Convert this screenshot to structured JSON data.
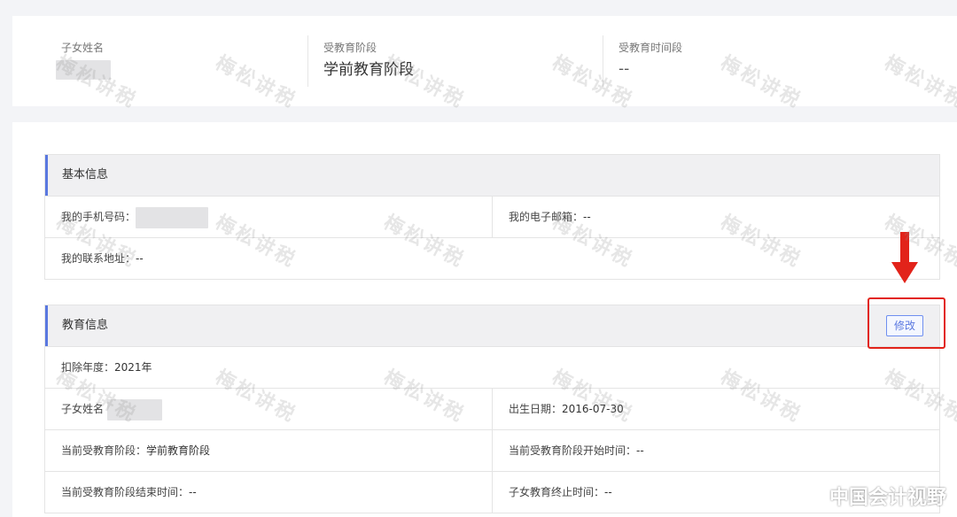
{
  "summary": {
    "child_name_label": "子女姓名",
    "edu_stage_label": "受教育阶段",
    "edu_stage_value": "学前教育阶段",
    "edu_period_label": "受教育时间段",
    "edu_period_value": "--"
  },
  "basic_info": {
    "title": "基本信息",
    "phone_label": "我的手机号码：",
    "email_label": "我的电子邮箱：",
    "email_value": "--",
    "address_label": "我的联系地址：",
    "address_value": "--"
  },
  "edu_info": {
    "title": "教育信息",
    "edit_label": "修改",
    "year_label": "扣除年度：",
    "year_value": "2021年",
    "child_name_label": "子女姓名",
    "birth_label": "出生日期：",
    "birth_value": "2016-07-30",
    "stage_label": "当前受教育阶段：",
    "stage_value": "学前教育阶段",
    "stage_start_label": "当前受教育阶段开始时间：",
    "stage_start_value": "--",
    "stage_end_label": "当前受教育阶段结束时间：",
    "stage_end_value": "--",
    "edu_end_label": "子女教育终止时间：",
    "edu_end_value": "--"
  },
  "watermark_text": "梅松讲税",
  "brand_text": "中国会计视野",
  "colors": {
    "accent": "#5a78e0",
    "highlight": "#e2231a"
  }
}
